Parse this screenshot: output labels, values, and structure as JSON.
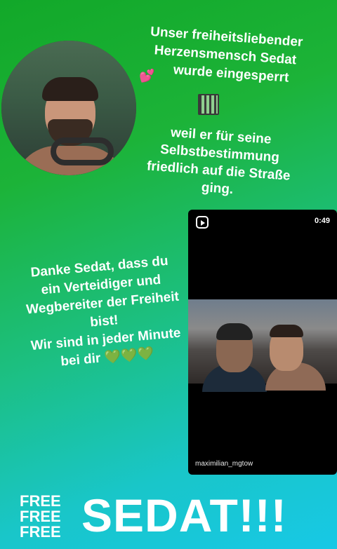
{
  "headline": {
    "lines": [
      "Unser freiheitsliebender",
      "Herzensmensch Sedat",
      "wurde eingesperrt"
    ]
  },
  "subtext": {
    "lines": [
      "weil er für seine",
      "Selbstbestimmung",
      "friedlich auf die Straße",
      "ging."
    ]
  },
  "reel": {
    "duration": "0:49",
    "username": "maximilian_mgtow"
  },
  "thanks": {
    "lines": [
      "Danke Sedat, dass du",
      "ein Verteidiger und",
      "Wegbereiter der Freiheit",
      "bist!",
      "Wir sind in jeder Minute",
      "bei dir 💚💚💚"
    ]
  },
  "footer": {
    "free_lines": [
      "FREE",
      "FREE",
      "FREE"
    ],
    "big_text": "SEDAT!!!"
  },
  "icons": {
    "pink_heart": "two-hearts-emoji",
    "jail": "prison-emoji",
    "reel": "reels-icon"
  },
  "colors": {
    "gradient_top": "#12a829",
    "gradient_bottom": "#17c8e6",
    "text": "#ffffff",
    "reel_bg": "#000000"
  }
}
